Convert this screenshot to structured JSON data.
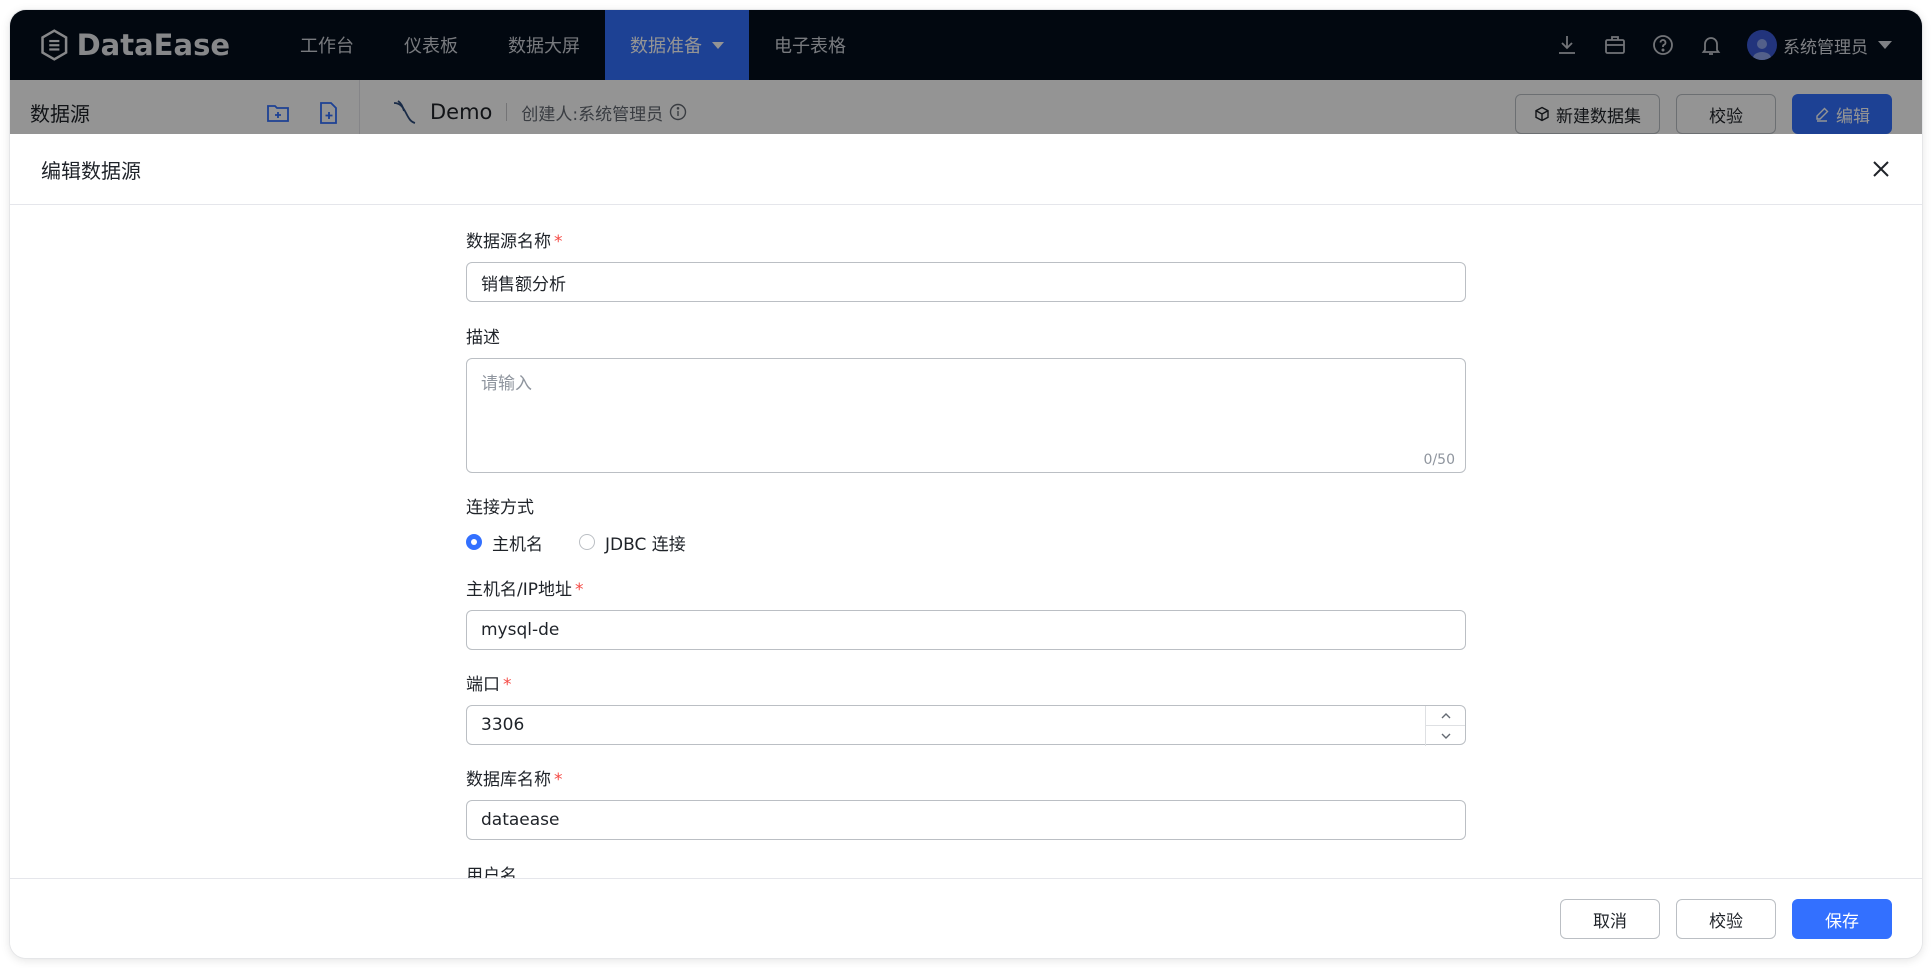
{
  "app": {
    "name": "DataEase"
  },
  "nav": {
    "items": [
      "工作台",
      "仪表板",
      "数据大屏",
      "数据准备",
      "电子表格"
    ],
    "active_index": 3,
    "user_name": "系统管理员",
    "icons": [
      "download-icon",
      "briefcase-icon",
      "help-icon",
      "bell-icon"
    ]
  },
  "subheader": {
    "title": "数据源",
    "datasource_name": "Demo",
    "creator": "创建人:系统管理员",
    "btn_new_dataset": "新建数据集",
    "btn_validate": "校验",
    "btn_edit": "编辑"
  },
  "drawer": {
    "title": "编辑数据源",
    "fields": {
      "name_label": "数据源名称",
      "name_value": "销售额分析",
      "desc_label": "描述",
      "desc_placeholder": "请输入",
      "desc_counter": "0/50",
      "conn_label": "连接方式",
      "conn_option_host": "主机名",
      "conn_option_jdbc": "JDBC 连接",
      "conn_selected": "主机名",
      "host_label": "主机名/IP地址",
      "host_value": "mysql-de",
      "port_label": "端口",
      "port_value": "3306",
      "db_label": "数据库名称",
      "db_value": "dataease",
      "user_label": "用户名"
    },
    "required_mark": "*",
    "footer": {
      "cancel": "取消",
      "validate": "校验",
      "save": "保存"
    }
  },
  "colors": {
    "primary": "#3370ff",
    "nav_bg": "#050e1c",
    "required": "#f54a45"
  }
}
